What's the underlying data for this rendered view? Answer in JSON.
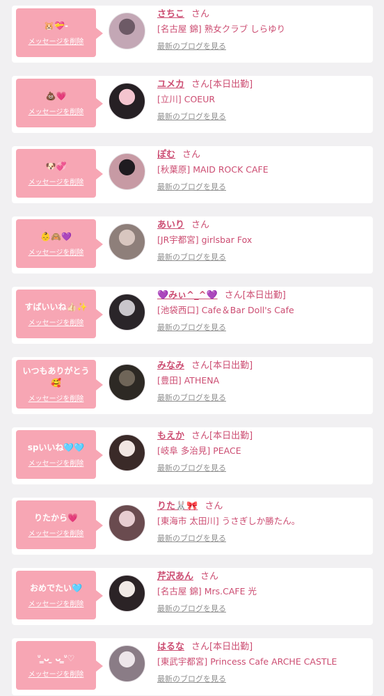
{
  "delete_label": "メッセージを削除",
  "blog_label": "最新のブログを見る",
  "messages": [
    {
      "bubble": "🐹💝-",
      "name": "さちこ",
      "san": "さん",
      "shop": "[名古屋 錦] 熟女クラブ しらゆり",
      "avatar_colors": [
        "#6d5a66",
        "#c3a7b5"
      ]
    },
    {
      "bubble": "💩💗",
      "name": "ユメカ",
      "san": "さん[本日出勤]",
      "shop": "[立川] COEUR",
      "avatar_colors": [
        "#f4c5cf",
        "#262024"
      ]
    },
    {
      "bubble": "🐶💞",
      "name": "ぽむ",
      "san": "さん",
      "shop": "[秋葉原] MAID ROCK CAFE",
      "avatar_colors": [
        "#1f1b20",
        "#c79aa4"
      ]
    },
    {
      "bubble": "👶🙈💜",
      "name": "あいり",
      "san": "さん",
      "shop": "[JR宇都宮] girlsbar Fox",
      "avatar_colors": [
        "#d8c6bf",
        "#8e7f7a"
      ]
    },
    {
      "bubble": "すばいいね👍🏻✨",
      "name": "💜みぃ^_^💜",
      "san": "さん[本日出勤]",
      "shop": "[池袋西口] Cafe＆Bar Doll's Cafe",
      "avatar_colors": [
        "#c9c6cb",
        "#2a2529"
      ]
    },
    {
      "bubble": "いつもありがとう🥰",
      "name": "みなみ",
      "san": "さん[本日出勤]",
      "shop": "[豊田] ATHENA",
      "avatar_colors": [
        "#6f6558",
        "#2d2924"
      ]
    },
    {
      "bubble": "spいいね🩵🩵",
      "name": "もえか",
      "san": "さん[本日出勤]",
      "shop": "[岐阜 多治見] PEACE",
      "avatar_colors": [
        "#f1e6e2",
        "#3a2a28"
      ]
    },
    {
      "bubble": "りたから💗",
      "name": "りた🐰🎀",
      "san": "さん",
      "shop": "[東海市 太田川] うさぎしか勝たん。",
      "avatar_colors": [
        "#e7cdd1",
        "#6a4b4f"
      ]
    },
    {
      "bubble": "おめでたい🩵",
      "name": "芹沢あん",
      "san": "さん",
      "shop": "[名古屋 錦] Mrs.CAFE 光",
      "avatar_colors": [
        "#f0e9e5",
        "#2b2326"
      ]
    },
    {
      "bubble": "ᐡ ̳ᴗ  ̫ ᴗ ̳ᐡ♡",
      "name": "はるな",
      "san": "さん[本日出勤]",
      "shop": "[東武宇都宮] Princess Cafe ARCHE CASTLE",
      "avatar_colors": [
        "#ede6ea",
        "#8a7c86"
      ]
    }
  ]
}
